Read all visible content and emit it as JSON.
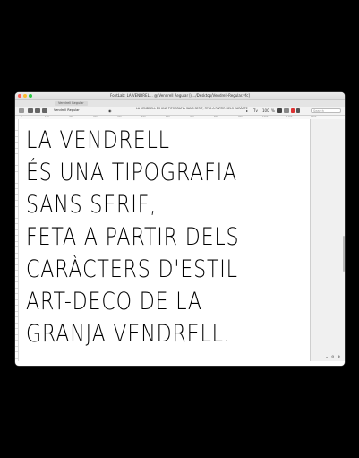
{
  "window": {
    "title": "FontLab: LA VENDREL… @ Vendrell Regular [/…/Desktop/Vendrell-Regular.vfc]",
    "tab_label": "Vendrell Regular"
  },
  "toolbar": {
    "font_select": "Vendrell Regular",
    "preview_text": "LA VENDRELL ÉS UNA TIPOGRAFIA SANS SERIF, FETA A PARTIR DELS CARÀCTE",
    "search_placeholder": "Search",
    "zoom_value": "100",
    "icon_tv": "Tv",
    "icon_pct": "%"
  },
  "ruler": {
    "ticks": [
      "0",
      "100",
      "200",
      "300",
      "400",
      "500",
      "600",
      "700",
      "800",
      "900",
      "1000",
      "1100",
      "1200"
    ]
  },
  "canvas": {
    "lines": [
      "LA VENDRELL",
      "ÉS UNA TIPOGRAFIA",
      "SANS SERIF,",
      "FETA A PARTIR DELS",
      "CARÀCTERS D'ESTIL",
      "ART-DECO DE LA",
      "GRANJA VENDRELL."
    ]
  }
}
